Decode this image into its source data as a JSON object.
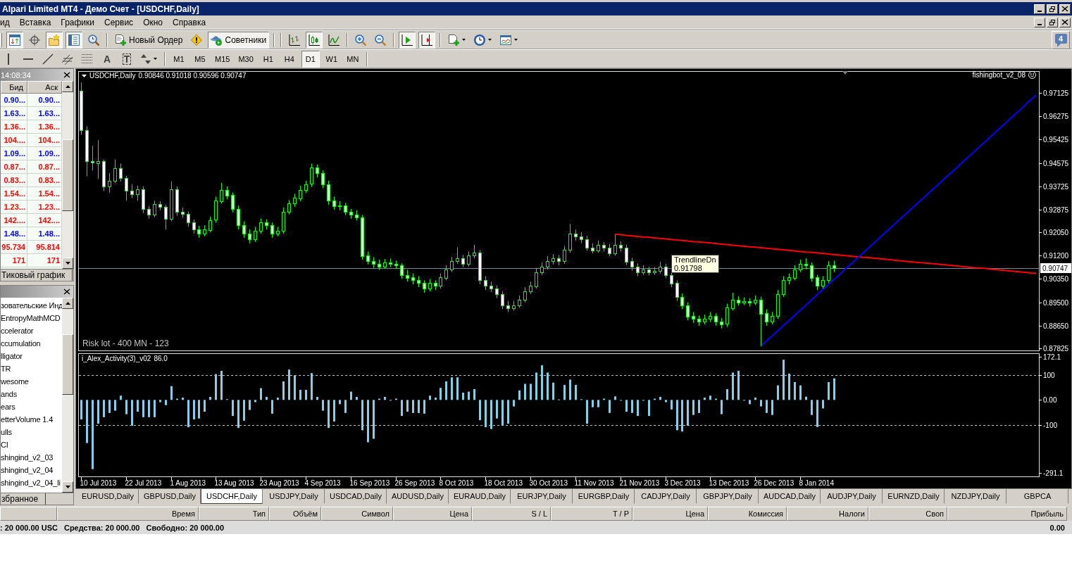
{
  "window": {
    "title": "Alpari Limited MT4 - Демо Счет - [USDCHF,Daily]"
  },
  "menu": [
    "ид",
    "Вставка",
    "Графики",
    "Сервис",
    "Окно",
    "Справка"
  ],
  "toolbar": {
    "buttons": [
      {
        "kind": "icon",
        "pressed": true
      },
      {
        "kind": "icon",
        "pressed": false
      },
      {
        "kind": "icon",
        "pressed": true
      },
      {
        "kind": "icon",
        "pressed": true
      },
      {
        "kind": "icon",
        "pressed": false
      },
      {
        "kind": "labeled",
        "label": "Новый Ордер",
        "pressed": false
      },
      {
        "kind": "icon",
        "pressed": false
      },
      {
        "kind": "labeled",
        "label": "Советники",
        "pressed": true
      },
      {
        "kind": "icon",
        "pressed": false
      },
      {
        "kind": "icon",
        "pressed": true
      },
      {
        "kind": "icon",
        "pressed": false
      },
      {
        "kind": "icon",
        "pressed": false
      },
      {
        "kind": "icon",
        "pressed": false
      },
      {
        "kind": "icon",
        "pressed": true
      },
      {
        "kind": "icon",
        "pressed": true
      },
      {
        "kind": "dropdown",
        "pressed": false
      },
      {
        "kind": "dropdown",
        "pressed": false
      },
      {
        "kind": "dropdown",
        "pressed": false
      }
    ],
    "notifications": "4"
  },
  "drawing_toolbar": {
    "tools": [
      {
        "kind": "icon",
        "pressed": false
      },
      {
        "kind": "icon",
        "pressed": false
      },
      {
        "kind": "icon",
        "pressed": false
      },
      {
        "kind": "icon",
        "pressed": false
      },
      {
        "kind": "icon",
        "pressed": false
      },
      {
        "kind": "glyph",
        "label": "A",
        "pressed": false
      },
      {
        "kind": "boxed",
        "label": "T",
        "pressed": false
      },
      {
        "kind": "dropdown",
        "pressed": false
      }
    ],
    "timeframes": [
      {
        "label": "M1",
        "selected": false
      },
      {
        "label": "M5",
        "selected": false
      },
      {
        "label": "M15",
        "selected": false
      },
      {
        "label": "M30",
        "selected": false
      },
      {
        "label": "H1",
        "selected": false
      },
      {
        "label": "H4",
        "selected": false
      },
      {
        "label": "D1",
        "selected": true
      },
      {
        "label": "W1",
        "selected": false
      },
      {
        "label": "MN",
        "selected": false
      }
    ]
  },
  "market_watch": {
    "time": "14:08:34",
    "columns": [
      "Бид",
      "Аск"
    ],
    "rows": [
      {
        "bid": "0.90...",
        "ask": "0.90...",
        "color": "#0000ff"
      },
      {
        "bid": "1.63...",
        "ask": "1.63...",
        "color": "#0000ff"
      },
      {
        "bid": "1.36...",
        "ask": "1.36...",
        "color": "#ff0000"
      },
      {
        "bid": "104....",
        "ask": "104....",
        "color": "#ff0000"
      },
      {
        "bid": "1.09...",
        "ask": "1.09...",
        "color": "#0000ff"
      },
      {
        "bid": "0.87...",
        "ask": "0.87...",
        "color": "#ff0000"
      },
      {
        "bid": "0.83...",
        "ask": "0.83...",
        "color": "#ff0000"
      },
      {
        "bid": "1.54...",
        "ask": "1.54...",
        "color": "#ff0000"
      },
      {
        "bid": "1.23...",
        "ask": "1.23...",
        "color": "#ff0000"
      },
      {
        "bid": "142....",
        "ask": "142....",
        "color": "#ff0000"
      },
      {
        "bid": "1.48...",
        "ask": "1.48...",
        "color": "#0000ff"
      },
      {
        "bid": "95.734",
        "ask": "95.814",
        "color": "#ff0000"
      },
      {
        "bid": "171",
        "ask": "171",
        "color": "#ff0000"
      }
    ],
    "tabs": [
      {
        "label": "Тиковый график",
        "selected": false
      }
    ]
  },
  "navigator": {
    "items": [
      {
        "label": "зовательские Инд",
        "children": [
          {
            "label": "EntropyMathMCD"
          },
          {
            "label": "ccelerator"
          },
          {
            "label": "ccumulation"
          },
          {
            "label": "lligator"
          },
          {
            "label": "TR"
          },
          {
            "label": "wesome"
          },
          {
            "label": "ands"
          },
          {
            "label": "ears"
          },
          {
            "label": "etterVolume 1.4"
          },
          {
            "label": "ulls"
          },
          {
            "label": "CI"
          },
          {
            "label": "shingind_v2_03"
          },
          {
            "label": "shingind_v2_04"
          },
          {
            "label": "shingind_v2_04_li"
          }
        ]
      }
    ],
    "tabs": [
      {
        "label": "збранное",
        "selected": false
      }
    ]
  },
  "chart": {
    "expert": "fishingbot_v2_08",
    "info": "Risk lot - 400 MN - 123",
    "tooltip": {
      "title": "TrendlineDn",
      "value": "0.91798"
    },
    "chart_data": [
      {
        "type": "candlestick",
        "title": "USDCHF,Daily",
        "subtitle": "0.90846 0.91018 0.90596 0.90747",
        "ylim": [
          0.87748,
          0.97919
        ],
        "categories": [
          null,
          null,
          null,
          null,
          null,
          null,
          null,
          null,
          null,
          null,
          null,
          null,
          null,
          null,
          null,
          null,
          null,
          null,
          null,
          null,
          null,
          null,
          null,
          null,
          null,
          null,
          null,
          null,
          null,
          null,
          null,
          null,
          null,
          null,
          null,
          null,
          null,
          null,
          null,
          null,
          null,
          null,
          null,
          null,
          null,
          null,
          null,
          null,
          null,
          null,
          null,
          null,
          null,
          null,
          null,
          null,
          null,
          null,
          null,
          null,
          null,
          null,
          null,
          null,
          null,
          null,
          null,
          null,
          null,
          null,
          null,
          null,
          null,
          null,
          null,
          null,
          null,
          null,
          null,
          null,
          null,
          null,
          null,
          null,
          null,
          null,
          null,
          null,
          null,
          null,
          null,
          null,
          null,
          null,
          null,
          null,
          null,
          null,
          null,
          null,
          null,
          null,
          null,
          null,
          null,
          null,
          null,
          null,
          null,
          null,
          null,
          null,
          null,
          null,
          null,
          null,
          null,
          null,
          null,
          null,
          null,
          null,
          null,
          null,
          null,
          null,
          null,
          null,
          null,
          null,
          null,
          null,
          null,
          null,
          null,
          null,
          null,
          null,
          null,
          null,
          null,
          null,
          null,
          null,
          null,
          null,
          null,
          null,
          null,
          null,
          null,
          null,
          null,
          null,
          null,
          null,
          null,
          null,
          null,
          null,
          null,
          null,
          null,
          null,
          null,
          null,
          null,
          null,
          null,
          null,
          null
        ],
        "yticks": [
          {
            "value": 0.97125,
            "label": "0.97125"
          },
          {
            "value": 0.96275,
            "label": "0.96275"
          },
          {
            "value": 0.95425,
            "label": "0.95425"
          },
          {
            "value": 0.94575,
            "label": "0.94575"
          },
          {
            "value": 0.93725,
            "label": "0.93725"
          },
          {
            "value": 0.92875,
            "label": "0.92875"
          },
          {
            "value": 0.9205,
            "label": "0.92050"
          },
          {
            "value": 0.912,
            "label": "0.91200"
          },
          {
            "value": 0.9035,
            "label": "0.90350"
          },
          {
            "value": 0.895,
            "label": "0.89500"
          },
          {
            "value": 0.8865,
            "label": "0.88650"
          },
          {
            "value": 0.87825,
            "label": "0.87825"
          }
        ],
        "ohlc": [
          [
            0.972,
            0.975,
            0.956,
            0.9576
          ],
          [
            0.9576,
            0.9591,
            0.9409,
            0.9463
          ],
          [
            0.9463,
            0.952,
            0.943,
            0.9457
          ],
          [
            0.9457,
            0.954,
            0.94,
            0.9464
          ],
          [
            0.9464,
            0.947,
            0.9355,
            0.9371
          ],
          [
            0.9371,
            0.942,
            0.935,
            0.9392
          ],
          [
            0.9392,
            0.947,
            0.9385,
            0.9438
          ],
          [
            0.9438,
            0.9455,
            0.939,
            0.9402
          ],
          [
            0.9402,
            0.941,
            0.932,
            0.9356
          ],
          [
            0.9356,
            0.938,
            0.933,
            0.9343
          ],
          [
            0.9343,
            0.9375,
            0.932,
            0.9361
          ],
          [
            0.9361,
            0.9372,
            0.9275,
            0.9289
          ],
          [
            0.9289,
            0.93,
            0.9255,
            0.9268
          ],
          [
            0.9268,
            0.932,
            0.926,
            0.9307
          ],
          [
            0.9307,
            0.9318,
            0.9285,
            0.9297
          ],
          [
            0.9297,
            0.9305,
            0.9215,
            0.9253
          ],
          [
            0.9253,
            0.939,
            0.9245,
            0.9361
          ],
          [
            0.9361,
            0.9372,
            0.9265,
            0.9279
          ],
          [
            0.9279,
            0.9295,
            0.9258,
            0.9272
          ],
          [
            0.9272,
            0.928,
            0.9225,
            0.924
          ],
          [
            0.924,
            0.9252,
            0.92,
            0.9215
          ],
          [
            0.9215,
            0.9228,
            0.9185,
            0.92
          ],
          [
            0.92,
            0.923,
            0.919,
            0.9215
          ],
          [
            0.9215,
            0.9262,
            0.9205,
            0.925
          ],
          [
            0.925,
            0.9335,
            0.924,
            0.932
          ],
          [
            0.932,
            0.9385,
            0.931,
            0.936
          ],
          [
            0.936,
            0.9372,
            0.9325,
            0.934
          ],
          [
            0.934,
            0.935,
            0.9278,
            0.929
          ],
          [
            0.929,
            0.9302,
            0.9215,
            0.923
          ],
          [
            0.923,
            0.9245,
            0.9185,
            0.92
          ],
          [
            0.92,
            0.9215,
            0.9165,
            0.918
          ],
          [
            0.918,
            0.9225,
            0.917,
            0.921
          ],
          [
            0.921,
            0.9255,
            0.92,
            0.924
          ],
          [
            0.924,
            0.9252,
            0.9215,
            0.923
          ],
          [
            0.923,
            0.924,
            0.9185,
            0.92
          ],
          [
            0.92,
            0.9225,
            0.919,
            0.921
          ],
          [
            0.921,
            0.9295,
            0.92,
            0.928
          ],
          [
            0.928,
            0.9322,
            0.927,
            0.931
          ],
          [
            0.931,
            0.9345,
            0.9298,
            0.933
          ],
          [
            0.933,
            0.9375,
            0.9318,
            0.936
          ],
          [
            0.936,
            0.9392,
            0.9348,
            0.938
          ],
          [
            0.938,
            0.9455,
            0.937,
            0.944
          ],
          [
            0.944,
            0.9452,
            0.9405,
            0.942
          ],
          [
            0.942,
            0.943,
            0.9365,
            0.938
          ],
          [
            0.938,
            0.9392,
            0.9305,
            0.932
          ],
          [
            0.932,
            0.9335,
            0.9288,
            0.93
          ],
          [
            0.93,
            0.9318,
            0.9285,
            0.9302
          ],
          [
            0.9302,
            0.9312,
            0.9268,
            0.928
          ],
          [
            0.928,
            0.929,
            0.9255,
            0.927
          ],
          [
            0.927,
            0.9285,
            0.9248,
            0.926
          ],
          [
            0.926,
            0.9268,
            0.9105,
            0.912
          ],
          [
            0.912,
            0.9135,
            0.9088,
            0.91
          ],
          [
            0.91,
            0.9115,
            0.9075,
            0.909
          ],
          [
            0.909,
            0.9105,
            0.9068,
            0.908
          ],
          [
            0.908,
            0.9108,
            0.9072,
            0.9095
          ],
          [
            0.9095,
            0.911,
            0.9078,
            0.909
          ],
          [
            0.909,
            0.9102,
            0.9072,
            0.9085
          ],
          [
            0.9085,
            0.9092,
            0.9035,
            0.905
          ],
          [
            0.905,
            0.9068,
            0.9025,
            0.904
          ],
          [
            0.904,
            0.9055,
            0.9015,
            0.903
          ],
          [
            0.903,
            0.9045,
            0.9005,
            0.902
          ],
          [
            0.902,
            0.903,
            0.8985,
            0.9
          ],
          [
            0.9,
            0.9035,
            0.899,
            0.902
          ],
          [
            0.902,
            0.903,
            0.8995,
            0.901
          ],
          [
            0.901,
            0.9055,
            0.9,
            0.904
          ],
          [
            0.904,
            0.9085,
            0.903,
            0.907
          ],
          [
            0.907,
            0.9115,
            0.906,
            0.91
          ],
          [
            0.91,
            0.915,
            0.909,
            0.911
          ],
          [
            0.911,
            0.9122,
            0.9078,
            0.909
          ],
          [
            0.909,
            0.9135,
            0.908,
            0.912
          ],
          [
            0.912,
            0.916,
            0.911,
            0.913
          ],
          [
            0.913,
            0.914,
            0.9015,
            0.903
          ],
          [
            0.903,
            0.9045,
            0.8995,
            0.901
          ],
          [
            0.901,
            0.9025,
            0.8988,
            0.9
          ],
          [
            0.9,
            0.9012,
            0.8965,
            0.898
          ],
          [
            0.898,
            0.899,
            0.8925,
            0.894
          ],
          [
            0.894,
            0.8955,
            0.8915,
            0.893
          ],
          [
            0.893,
            0.8955,
            0.892,
            0.894
          ],
          [
            0.894,
            0.8975,
            0.893,
            0.896
          ],
          [
            0.896,
            0.9005,
            0.895,
            0.899
          ],
          [
            0.899,
            0.9025,
            0.898,
            0.901
          ],
          [
            0.901,
            0.9075,
            0.9,
            0.906
          ],
          [
            0.906,
            0.9095,
            0.905,
            0.908
          ],
          [
            0.908,
            0.9118,
            0.907,
            0.91
          ],
          [
            0.91,
            0.9125,
            0.9088,
            0.911
          ],
          [
            0.911,
            0.9122,
            0.9085,
            0.91
          ],
          [
            0.91,
            0.9155,
            0.909,
            0.914
          ],
          [
            0.914,
            0.9235,
            0.913,
            0.92
          ],
          [
            0.92,
            0.9215,
            0.9175,
            0.919
          ],
          [
            0.919,
            0.9205,
            0.9165,
            0.918
          ],
          [
            0.918,
            0.9192,
            0.9138,
            0.915
          ],
          [
            0.915,
            0.9165,
            0.9128,
            0.914
          ],
          [
            0.914,
            0.9175,
            0.913,
            0.916
          ],
          [
            0.916,
            0.917,
            0.9135,
            0.915
          ],
          [
            0.915,
            0.9162,
            0.9118,
            0.913
          ],
          [
            0.913,
            0.9195,
            0.912,
            0.916
          ],
          [
            0.916,
            0.9172,
            0.9135,
            0.915
          ],
          [
            0.915,
            0.916,
            0.9085,
            0.91
          ],
          [
            0.91,
            0.9112,
            0.9065,
            0.908
          ],
          [
            0.908,
            0.9092,
            0.9045,
            0.906
          ],
          [
            0.906,
            0.9085,
            0.905,
            0.907
          ],
          [
            0.907,
            0.908,
            0.9048,
            0.906
          ],
          [
            0.906,
            0.9078,
            0.905,
            0.9065
          ],
          [
            0.9065,
            0.9098,
            0.9055,
            0.908
          ],
          [
            0.908,
            0.909,
            0.9038,
            0.905
          ],
          [
            0.905,
            0.9062,
            0.9005,
            0.902
          ],
          [
            0.902,
            0.903,
            0.8955,
            0.897
          ],
          [
            0.897,
            0.8982,
            0.8925,
            0.894
          ],
          [
            0.894,
            0.895,
            0.8885,
            0.89
          ],
          [
            0.89,
            0.8915,
            0.8875,
            0.889
          ],
          [
            0.889,
            0.8902,
            0.8865,
            0.888
          ],
          [
            0.888,
            0.8905,
            0.887,
            0.889
          ],
          [
            0.889,
            0.8915,
            0.8878,
            0.89
          ],
          [
            0.89,
            0.891,
            0.8865,
            0.888
          ],
          [
            0.888,
            0.8892,
            0.8855,
            0.887
          ],
          [
            0.887,
            0.8945,
            0.886,
            0.893
          ],
          [
            0.893,
            0.8985,
            0.892,
            0.896
          ],
          [
            0.896,
            0.8972,
            0.8938,
            0.895
          ],
          [
            0.895,
            0.8968,
            0.894,
            0.8955
          ],
          [
            0.8955,
            0.8965,
            0.8935,
            0.895
          ],
          [
            0.895,
            0.8975,
            0.894,
            0.896
          ],
          [
            0.896,
            0.897,
            0.879,
            0.891
          ],
          [
            0.891,
            0.8925,
            0.8865,
            0.888
          ],
          [
            0.888,
            0.8915,
            0.887,
            0.89
          ],
          [
            0.89,
            0.8995,
            0.889,
            0.898
          ],
          [
            0.898,
            0.9045,
            0.897,
            0.903
          ],
          [
            0.903,
            0.9055,
            0.9015,
            0.904
          ],
          [
            0.904,
            0.9085,
            0.903,
            0.907
          ],
          [
            0.907,
            0.9105,
            0.906,
            0.909
          ],
          [
            0.909,
            0.911,
            0.907,
            0.9085
          ],
          [
            0.9085,
            0.9095,
            0.9025,
            0.904
          ],
          [
            0.904,
            0.905,
            0.8995,
            0.901
          ],
          [
            0.901,
            0.9045,
            0.9,
            0.903
          ],
          [
            0.903,
            0.91,
            0.902,
            0.9085
          ],
          [
            0.90846,
            0.91018,
            0.90596,
            0.90747
          ],
          null,
          null,
          null,
          null,
          null,
          null,
          null,
          null,
          null,
          null,
          null,
          null,
          null,
          null,
          null,
          null,
          null,
          null,
          null,
          null,
          null,
          null,
          null,
          null,
          null,
          null,
          null,
          null,
          null,
          null,
          null,
          null,
          null,
          null,
          null,
          null
        ],
        "series": [
          {
            "type": "line",
            "color": "#ff0000",
            "values": [
              null,
              null,
              null,
              null,
              null,
              null,
              null,
              null,
              null,
              null,
              null,
              null,
              null,
              null,
              null,
              null,
              null,
              null,
              null,
              null,
              null,
              null,
              null,
              null,
              null,
              null,
              null,
              null,
              null,
              null,
              null,
              null,
              null,
              null,
              null,
              null,
              null,
              null,
              null,
              null,
              null,
              null,
              null,
              null,
              null,
              null,
              null,
              null,
              null,
              null,
              null,
              null,
              null,
              null,
              null,
              null,
              null,
              null,
              null,
              null,
              null,
              null,
              null,
              null,
              null,
              null,
              null,
              null,
              null,
              null,
              null,
              null,
              null,
              null,
              null,
              null,
              null,
              null,
              null,
              null,
              null,
              null,
              null,
              null,
              null,
              null,
              null,
              null,
              null,
              null,
              null,
              null,
              null,
              null,
              null,
              0.9198,
              0.9196,
              0.9194,
              0.9192,
              0.919,
              0.9188,
              0.9187,
              0.9185,
              0.9183,
              0.9181,
              0.9179,
              0.9177,
              0.9175,
              0.9173,
              0.9171,
              0.917,
              0.9168,
              0.9166,
              0.9164,
              0.9162,
              0.916,
              0.9158,
              0.9156,
              0.9154,
              0.9152,
              0.9151,
              0.9149,
              0.9147,
              0.9145,
              0.9143,
              0.9141,
              0.9139,
              0.9137,
              0.9135,
              0.9133,
              0.9132,
              0.913,
              0.9128,
              0.9126,
              0.9124,
              0.9122,
              0.912,
              0.9118,
              0.9116,
              0.9114,
              0.9113,
              0.9111,
              0.9109,
              0.9107,
              0.9105,
              0.9103,
              0.9101,
              0.9099,
              0.9097,
              0.9095,
              0.9094,
              0.9092,
              0.909,
              0.9088,
              0.9086,
              0.9084,
              0.9082,
              0.908,
              0.9078,
              0.9076,
              0.9075,
              0.9073,
              0.9071,
              0.9069,
              0.9067,
              0.9065,
              0.9063,
              0.9061,
              0.9059,
              0.9057,
              0.9056
            ]
          },
          {
            "type": "line",
            "color": "#0000ff",
            "values": [
              null,
              null,
              null,
              null,
              null,
              null,
              null,
              null,
              null,
              null,
              null,
              null,
              null,
              null,
              null,
              null,
              null,
              null,
              null,
              null,
              null,
              null,
              null,
              null,
              null,
              null,
              null,
              null,
              null,
              null,
              null,
              null,
              null,
              null,
              null,
              null,
              null,
              null,
              null,
              null,
              null,
              null,
              null,
              null,
              null,
              null,
              null,
              null,
              null,
              null,
              null,
              null,
              null,
              null,
              null,
              null,
              null,
              null,
              null,
              null,
              null,
              null,
              null,
              null,
              null,
              null,
              null,
              null,
              null,
              null,
              null,
              null,
              null,
              null,
              null,
              null,
              null,
              null,
              null,
              null,
              null,
              null,
              null,
              null,
              null,
              null,
              null,
              null,
              null,
              null,
              null,
              null,
              null,
              null,
              null,
              null,
              null,
              null,
              null,
              null,
              null,
              null,
              null,
              null,
              null,
              null,
              null,
              null,
              null,
              null,
              null,
              null,
              null,
              null,
              null,
              null,
              null,
              null,
              null,
              null,
              null,
              0.879,
              0.8809,
              0.8827,
              0.8846,
              0.8865,
              0.8883,
              0.8902,
              0.8921,
              0.8939,
              0.8958,
              0.8977,
              0.8995,
              0.9014,
              0.9033,
              0.9051,
              0.907,
              0.9089,
              0.9107,
              0.9126,
              0.9145,
              0.9163,
              0.9182,
              0.9201,
              0.9219,
              0.9238,
              0.9257,
              0.9275,
              0.9294,
              0.9313,
              0.9331,
              0.935,
              0.9368,
              0.9387,
              0.9406,
              0.9424,
              0.9443,
              0.9462,
              0.948,
              0.9499,
              0.9518,
              0.9536,
              0.9555,
              0.9574,
              0.9592,
              0.9611,
              0.963,
              0.9648,
              0.9667,
              0.9686,
              0.9704
            ]
          }
        ],
        "ref_lines": [
          {
            "axis": "y",
            "value": 0.90747,
            "label": "0.90747",
            "color": "#778899"
          }
        ]
      },
      {
        "type": "bar",
        "title": "i_Alex_Activity(3)_v02",
        "subtitle": "86.0",
        "color": "#87ceeb",
        "ylim": [
          -305,
          186
        ],
        "yticks": [
          {
            "value": 172.1,
            "label": "172.1"
          },
          {
            "value": 100,
            "label": "100"
          },
          {
            "value": 0,
            "label": "0.00"
          },
          {
            "value": -100,
            "label": "-100"
          },
          {
            "value": -291.1,
            "label": "-291.1"
          }
        ],
        "ref_lines": [
          {
            "axis": "y",
            "value": 100,
            "line_style": "dashed"
          },
          {
            "axis": "y",
            "value": -100,
            "line_style": "dashed"
          }
        ],
        "categories": [
          null,
          null,
          null,
          null,
          null,
          null,
          null,
          null,
          null,
          null,
          null,
          null,
          null,
          null,
          null,
          null,
          null,
          null,
          null,
          null,
          null,
          null,
          null,
          null,
          null,
          null,
          null,
          null,
          null,
          null,
          null,
          null,
          null,
          null,
          null,
          null,
          null,
          null,
          null,
          null,
          null,
          null,
          null,
          null,
          null,
          null,
          null,
          null,
          null,
          null,
          null,
          null,
          null,
          null,
          null,
          null,
          null,
          null,
          null,
          null,
          null,
          null,
          null,
          null,
          null,
          null,
          null,
          null,
          null,
          null,
          null,
          null,
          null,
          null,
          null,
          null,
          null,
          null,
          null,
          null,
          null,
          null,
          null,
          null,
          null,
          null,
          null,
          null,
          null,
          null,
          null,
          null,
          null,
          null,
          null,
          null,
          null,
          null,
          null,
          null,
          null,
          null,
          null,
          null,
          null,
          null,
          null,
          null,
          null,
          null,
          null,
          null,
          null,
          null,
          null,
          null,
          null,
          null,
          null,
          null,
          null,
          null,
          null,
          null,
          null,
          null,
          null,
          null,
          null,
          null,
          null,
          null,
          null,
          null,
          null,
          null,
          null,
          null,
          null,
          null,
          null,
          null,
          null,
          null,
          null,
          null,
          null,
          null,
          null,
          null,
          null,
          null,
          null,
          null,
          null,
          null,
          null,
          null,
          null,
          null,
          null,
          null,
          null,
          null,
          null,
          null,
          null,
          null,
          null,
          null,
          null
        ],
        "values": [
          -78,
          -172,
          -276,
          -95,
          -69,
          -52,
          -43,
          17,
          -57,
          -103,
          -47,
          -69,
          -69,
          -69,
          -9,
          -21,
          55,
          5,
          9,
          -109,
          -78,
          -74,
          -47,
          12,
          103,
          116,
          3,
          -64,
          -112,
          -83,
          -40,
          -9,
          47,
          12,
          -55,
          9,
          74,
          121,
          98,
          40,
          40,
          107,
          12,
          -43,
          -112,
          -86,
          -17,
          -52,
          33,
          12,
          -121,
          -169,
          -155,
          5,
          12,
          -3,
          5,
          -64,
          -47,
          -52,
          -52,
          -55,
          17,
          9,
          48,
          74,
          90,
          90,
          29,
          33,
          43,
          -81,
          -109,
          -116,
          -74,
          -100,
          -95,
          -26,
          38,
          64,
          64,
          109,
          138,
          109,
          69,
          2,
          60,
          81,
          60,
          3,
          -95,
          -29,
          -29,
          5,
          -52,
          14,
          -2,
          -47,
          -52,
          -64,
          -3,
          -64,
          5,
          12,
          -9,
          -38,
          -121,
          -126,
          -103,
          -60,
          -52,
          9,
          17,
          5,
          -57,
          43,
          109,
          116,
          -2,
          -17,
          9,
          -26,
          -52,
          -60,
          58,
          160,
          105,
          71,
          58,
          13,
          -60,
          -108,
          -34,
          71,
          86,
          null,
          null,
          null,
          null,
          null,
          null,
          null,
          null,
          null,
          null,
          null,
          null,
          null,
          null,
          null,
          null,
          null,
          null,
          null,
          null,
          null,
          null,
          null,
          null,
          null,
          null,
          null,
          null,
          null,
          null,
          null,
          null,
          null,
          null,
          null,
          null
        ]
      }
    ],
    "time_scale": [
      "10 Jul 2013",
      "22 Jul 2013",
      "1 Aug 2013",
      "13 Aug 2013",
      "23 Aug 2013",
      "4 Sep 2013",
      "16 Sep 2013",
      "26 Sep 2013",
      "8 Oct 2013",
      "18 Oct 2013",
      "30 Oct 2013",
      "11 Nov 2013",
      "21 Nov 2013",
      "3 Dec 2013",
      "13 Dec 2013",
      "26 Dec 2013",
      "8 Jan 2014"
    ]
  },
  "chart_tabs": [
    {
      "label": "EURUSD,Daily",
      "selected": false
    },
    {
      "label": "GBPUSD,Daily",
      "selected": false
    },
    {
      "label": "USDCHF,Daily",
      "selected": true
    },
    {
      "label": "USDJPY,Daily",
      "selected": false
    },
    {
      "label": "USDCAD,Daily",
      "selected": false
    },
    {
      "label": "AUDUSD,Daily",
      "selected": false
    },
    {
      "label": "EURAUD,Daily",
      "selected": false
    },
    {
      "label": "EURJPY,Daily",
      "selected": false
    },
    {
      "label": "EURGBP,Daily",
      "selected": false
    },
    {
      "label": "CADJPY,Daily",
      "selected": false
    },
    {
      "label": "GBPJPY,Daily",
      "selected": false
    },
    {
      "label": "AUDCAD,Daily",
      "selected": false
    },
    {
      "label": "AUDJPY,Daily",
      "selected": false
    },
    {
      "label": "EURNZD,Daily",
      "selected": false
    },
    {
      "label": "NZDJPY,Daily",
      "selected": false
    },
    {
      "label": "GBPCA",
      "selected": false
    }
  ],
  "terminal": {
    "columns": [
      "Время",
      "Тип",
      "Объём",
      "Символ",
      "Цена",
      "S / L",
      "T / P",
      "Цена",
      "Комиссия",
      "Налоги",
      "Своп",
      "Прибыль"
    ],
    "balance": ": 20 000.00 USC",
    "equity": "Средства: 20 000.00",
    "free_margin": "Свободно: 20 000.00",
    "profit": "0.00"
  }
}
